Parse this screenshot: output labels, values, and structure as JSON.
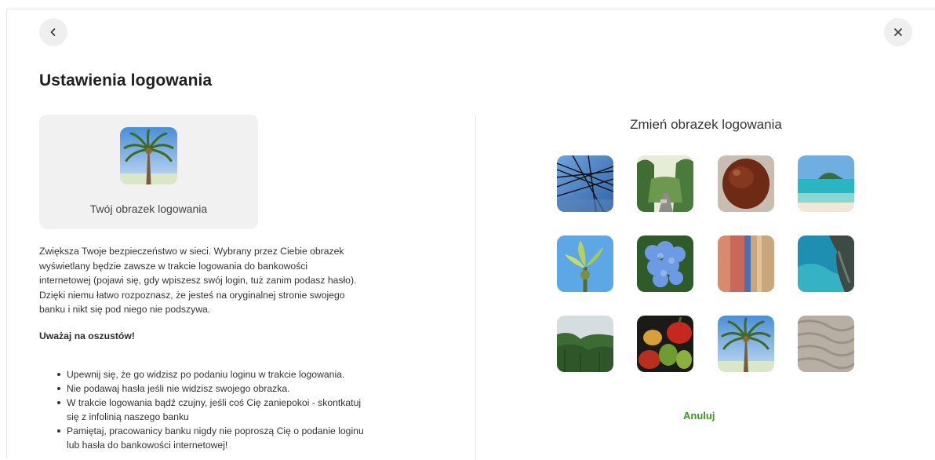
{
  "nav": {
    "back_icon": "chevron-left-icon",
    "close_icon": "close-icon"
  },
  "page": {
    "title": "Ustawienia logowania"
  },
  "current": {
    "label": "Twój obrazek logowania"
  },
  "description": "Zwiększa Twoje bezpieczeństwo w sieci. Wybrany przez Ciebie obrazek wyświetlany będzie zawsze w trakcie logowania do bankowości internetowej (pojawi się, gdy wpiszesz swój login, tuż zanim podasz hasło). Dzięki niemu łatwo rozpoznasz, że jesteś na oryginalnej stronie swojego banku i nikt się pod niego nie podszywa.",
  "warning": {
    "title": "Uważaj na oszustów!",
    "tips": [
      "Upewnij się, że go widzisz po podaniu loginu w trakcie logowania.",
      "Nie podawaj hasła jeśli nie widzisz swojego obrazka.",
      "W trakcie logowania bądź czujny, jeśli coś Cię zaniepokoi - skontkatuj się z infolinią naszego banku",
      "Pamiętaj, pracowanicy banku nigdy nie poproszą Cię o podanie loginu lub hasła do bankowości internetowej!"
    ]
  },
  "picker": {
    "title": "Zmień obrazek logowania",
    "images": [
      "power-lines-picture",
      "forest-road-picture",
      "coconut-picture",
      "tropical-beach-picture",
      "young-leaves-picture",
      "hydrangea-picture",
      "painted-wall-picture",
      "rocky-coast-picture",
      "misty-forest-picture",
      "vegetables-picture",
      "palm-tree-picture",
      "sand-ripples-picture"
    ],
    "cancel_label": "Anuluj"
  },
  "colors": {
    "accent": "#3a9b1c",
    "card_bg": "#f1f1f1"
  }
}
